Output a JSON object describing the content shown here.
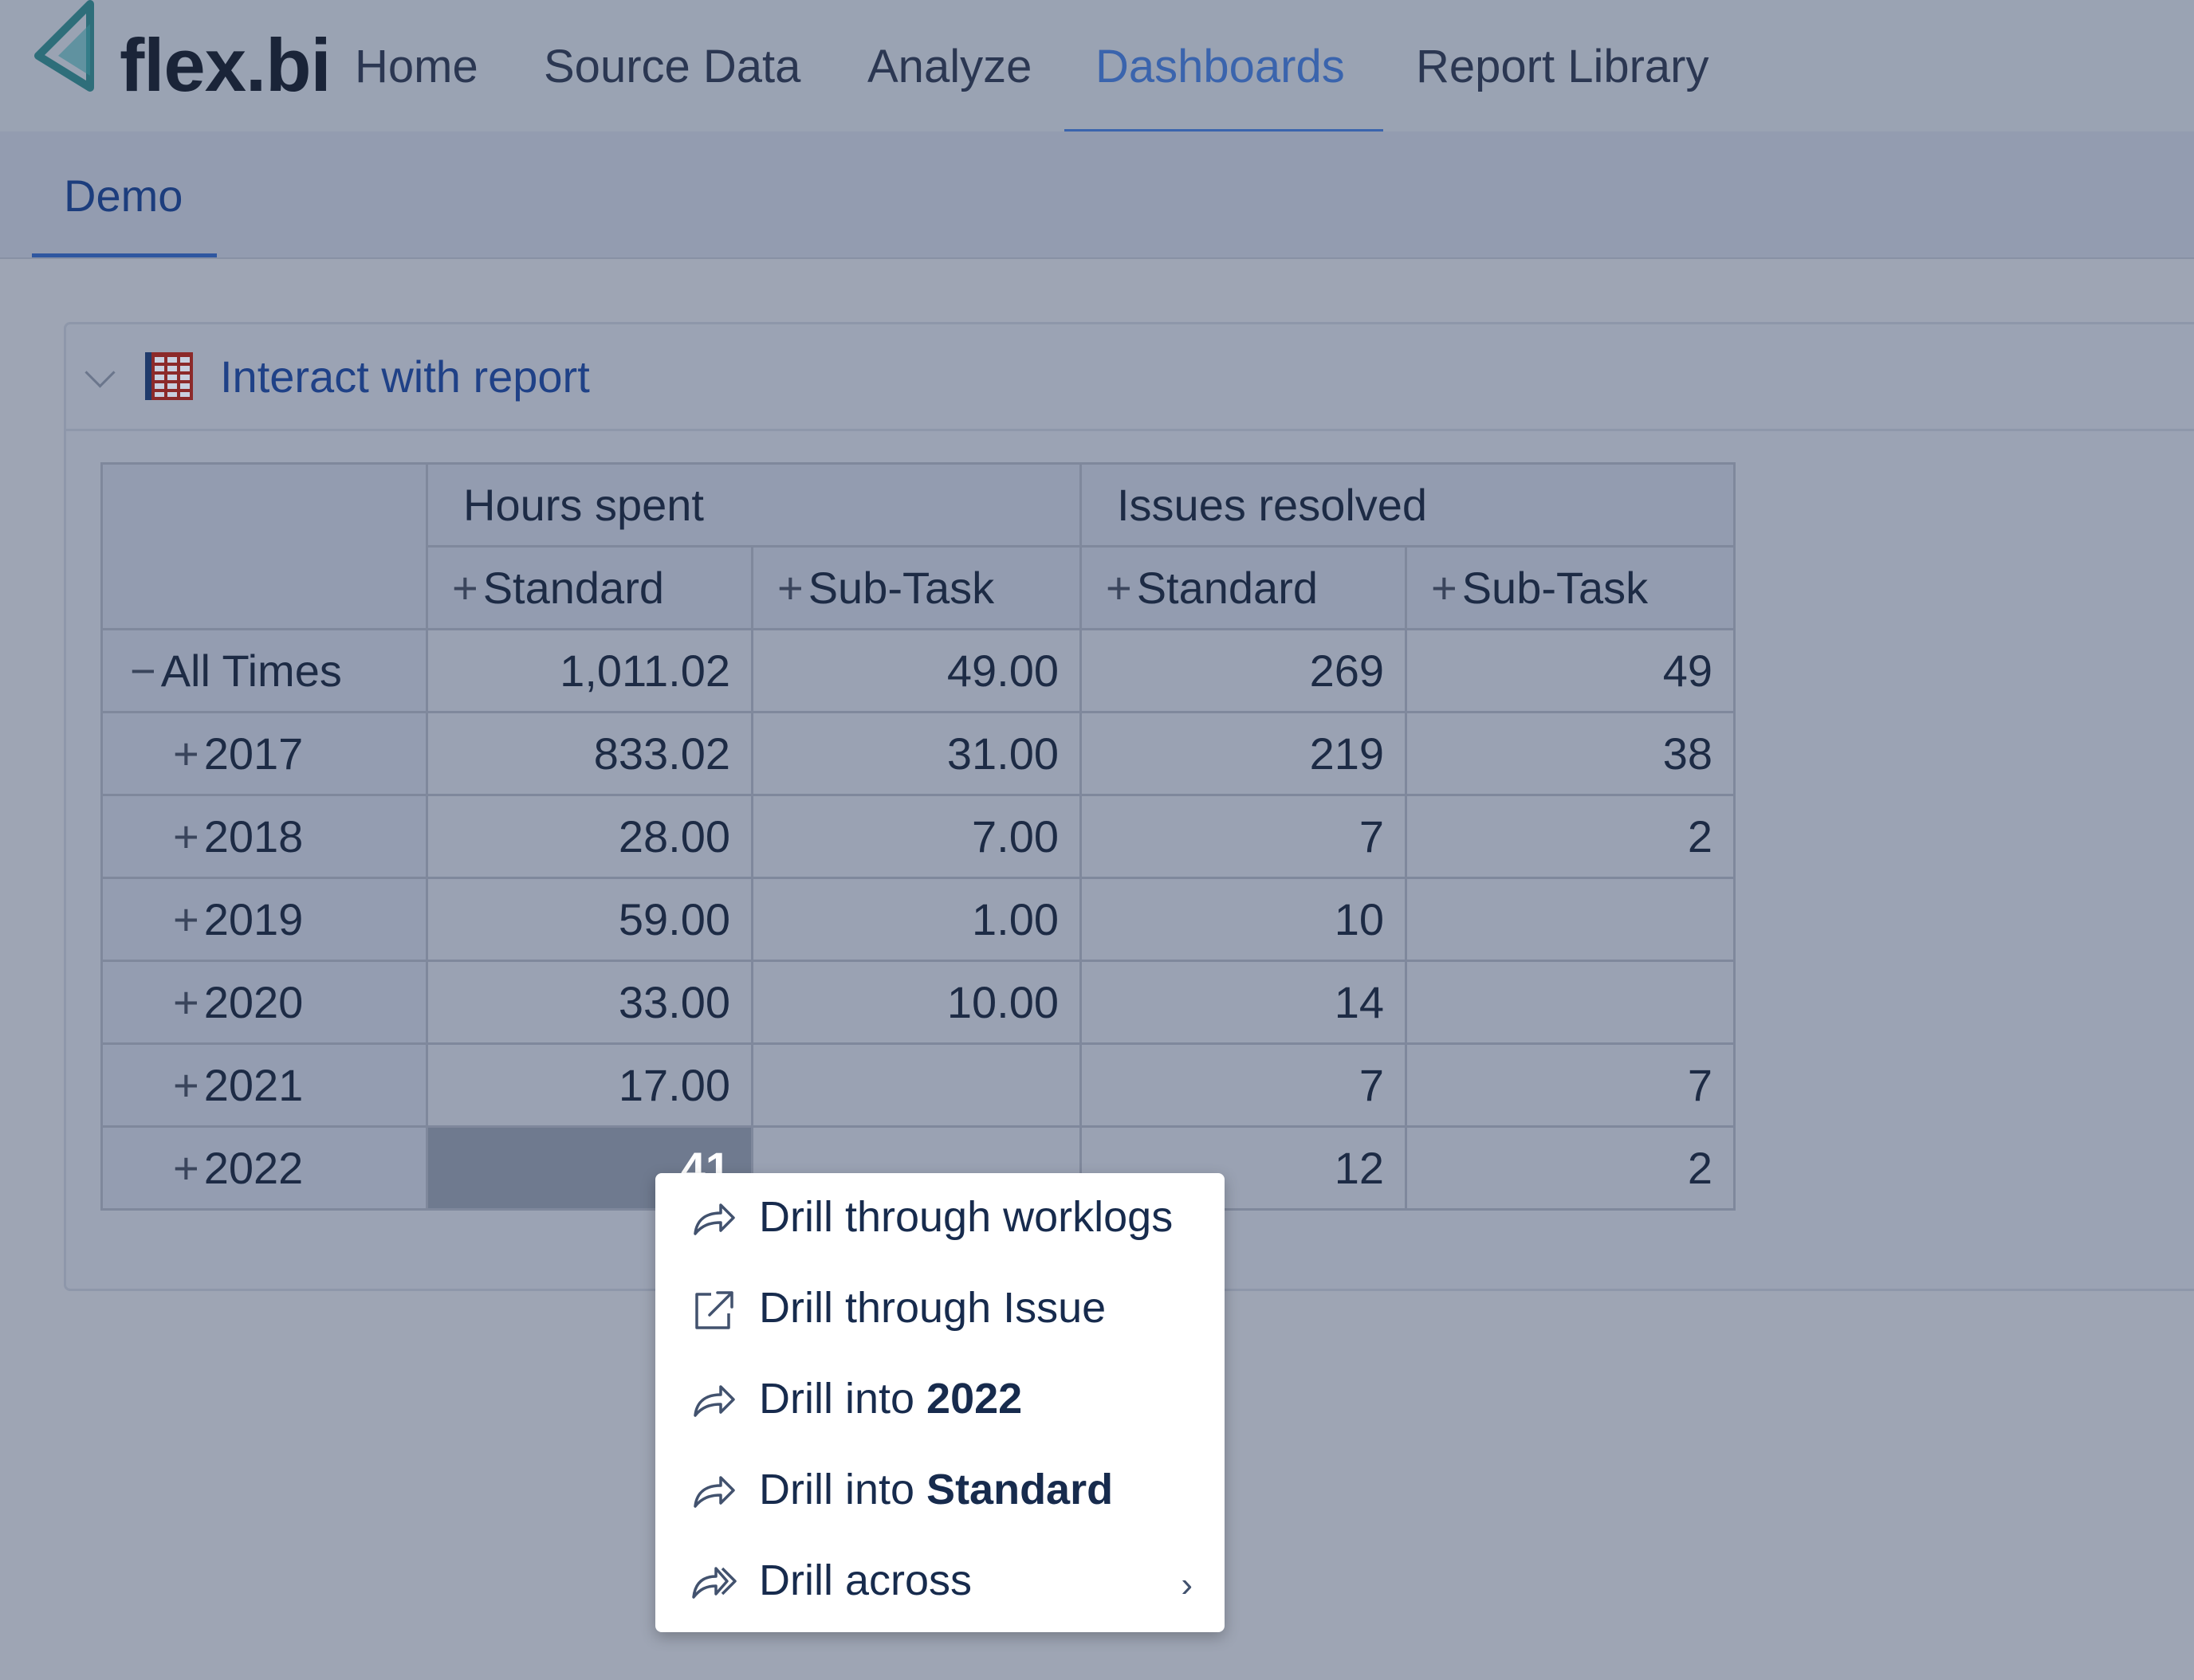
{
  "app": {
    "logo_text": "flex.bi"
  },
  "nav": {
    "items": [
      {
        "label": "Home"
      },
      {
        "label": "Source Data"
      },
      {
        "label": "Analyze"
      },
      {
        "label": "Dashboards"
      },
      {
        "label": "Report Library"
      }
    ],
    "active": "Dashboards"
  },
  "subnav": {
    "tab": "Demo"
  },
  "panel": {
    "title": "Interact with report"
  },
  "table": {
    "col_groups": [
      "Hours spent",
      "Issues resolved"
    ],
    "col_headers": [
      "Standard",
      "Sub-Task",
      "Standard",
      "Sub-Task"
    ],
    "expand_symbol": "+",
    "collapse_symbol": "−",
    "rows": [
      {
        "label": "All Times",
        "values": [
          "1,011.02",
          "49.00",
          "269",
          "49"
        ]
      },
      {
        "label": "2017",
        "values": [
          "833.02",
          "31.00",
          "219",
          "38"
        ]
      },
      {
        "label": "2018",
        "values": [
          "28.00",
          "7.00",
          "7",
          "2"
        ]
      },
      {
        "label": "2019",
        "values": [
          "59.00",
          "1.00",
          "10",
          ""
        ]
      },
      {
        "label": "2020",
        "values": [
          "33.00",
          "10.00",
          "14",
          ""
        ]
      },
      {
        "label": "2021",
        "values": [
          "17.00",
          "",
          "7",
          "7"
        ]
      },
      {
        "label": "2022",
        "values": [
          "41",
          "",
          "12",
          "2"
        ]
      }
    ]
  },
  "context_menu": {
    "items": [
      {
        "prefix": "Drill through worklogs",
        "bold": "",
        "icon": "share-arrow-icon"
      },
      {
        "prefix": "Drill through Issue",
        "bold": "",
        "icon": "external-link-icon"
      },
      {
        "prefix": "Drill into ",
        "bold": "2022",
        "icon": "share-arrow-icon"
      },
      {
        "prefix": "Drill into ",
        "bold": "Standard",
        "icon": "share-arrow-icon"
      },
      {
        "prefix": "Drill across",
        "bold": "",
        "icon": "double-share-arrow-icon"
      }
    ],
    "submenu_arrow": "›"
  },
  "colors": {
    "accent": "#3a64ad",
    "overlay_bg": "#9ea5b4",
    "selected_cell": "#6f7a8f",
    "menu_bg": "#ffffff"
  }
}
